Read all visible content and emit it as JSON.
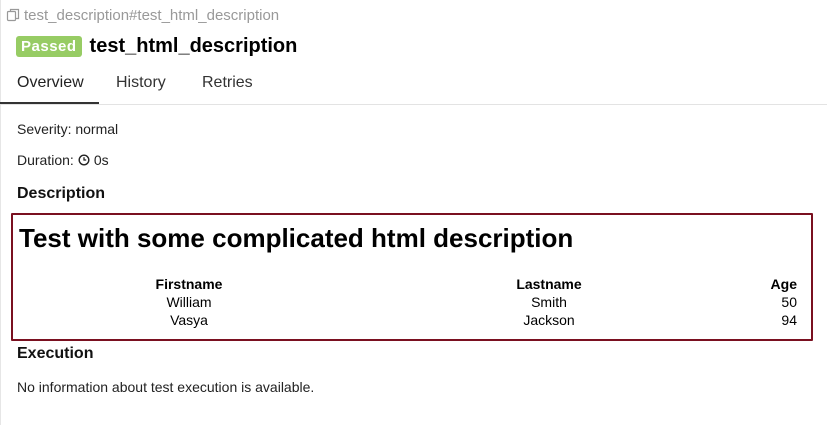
{
  "breadcrumb": "test_description#test_html_description",
  "status": "Passed",
  "test_name": "test_html_description",
  "tabs": [
    "Overview",
    "History",
    "Retries"
  ],
  "severity": "Severity: normal",
  "duration": {
    "label": "Duration:",
    "value": "0s"
  },
  "description": {
    "section_title": "Description",
    "heading": "Test with some complicated html description",
    "columns": [
      "Firstname",
      "Lastname",
      "Age"
    ],
    "rows": [
      [
        "William",
        "Smith",
        "50"
      ],
      [
        "Vasya",
        "Jackson",
        "94"
      ]
    ]
  },
  "execution": {
    "section_title": "Execution",
    "text": "No information about test execution is available."
  },
  "colors": {
    "passed_badge": "#97cc64",
    "description_border": "#7a1020"
  }
}
